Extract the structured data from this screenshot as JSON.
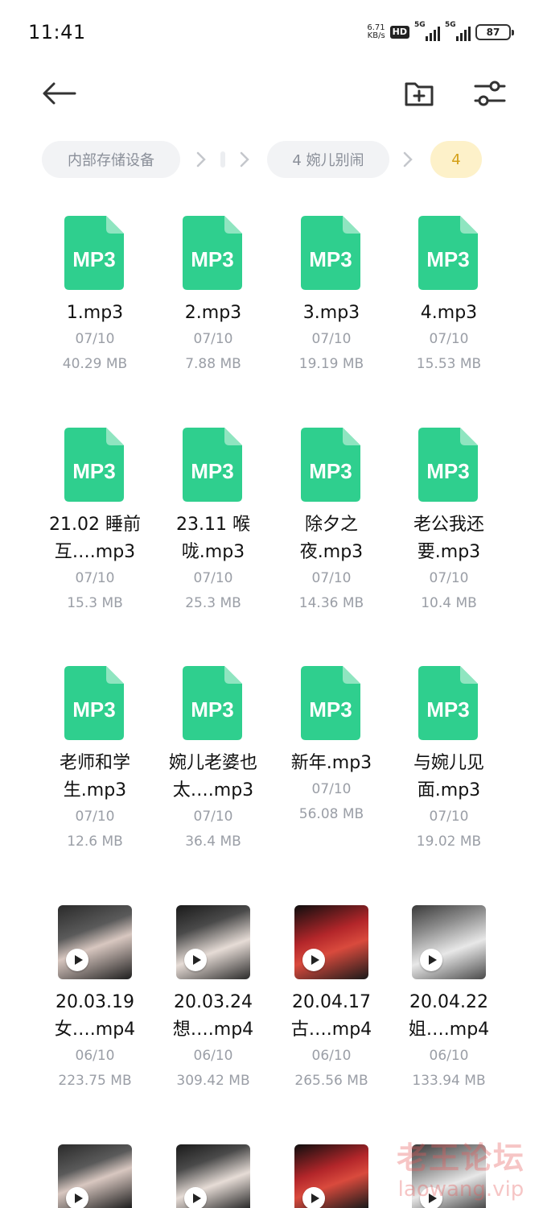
{
  "status": {
    "time": "11:41",
    "netspeed_value": "6.71",
    "netspeed_unit": "KB/s",
    "hd": "HD",
    "sim1": "5G",
    "sim2": "5G",
    "battery": "87"
  },
  "toolbar": {
    "back_icon": "arrow-left-icon",
    "new_folder_icon": "folder-add-icon",
    "filter_icon": "sliders-icon"
  },
  "breadcrumb": {
    "items": [
      "内部存储设备",
      "4 婉儿别闹",
      "4"
    ],
    "active_color": "#d4a017"
  },
  "files": [
    {
      "name_line1": "1.mp3",
      "name_line2": "",
      "date": "07/10",
      "size": "40.29 MB",
      "type": "MP3"
    },
    {
      "name_line1": "2.mp3",
      "name_line2": "",
      "date": "07/10",
      "size": "7.88 MB",
      "type": "MP3"
    },
    {
      "name_line1": "3.mp3",
      "name_line2": "",
      "date": "07/10",
      "size": "19.19 MB",
      "type": "MP3"
    },
    {
      "name_line1": "4.mp3",
      "name_line2": "",
      "date": "07/10",
      "size": "15.53 MB",
      "type": "MP3"
    },
    {
      "name_line1": "21.02 睡前",
      "name_line2": "互….mp3",
      "date": "07/10",
      "size": "15.3 MB",
      "type": "MP3"
    },
    {
      "name_line1": "23.11 喉",
      "name_line2": "咙.mp3",
      "date": "07/10",
      "size": "25.3 MB",
      "type": "MP3"
    },
    {
      "name_line1": "除夕之",
      "name_line2": "夜.mp3",
      "date": "07/10",
      "size": "14.36 MB",
      "type": "MP3"
    },
    {
      "name_line1": "老公我还",
      "name_line2": "要.mp3",
      "date": "07/10",
      "size": "10.4 MB",
      "type": "MP3"
    },
    {
      "name_line1": "老师和学",
      "name_line2": "生.mp3",
      "date": "07/10",
      "size": "12.6 MB",
      "type": "MP3"
    },
    {
      "name_line1": "婉儿老婆也",
      "name_line2": "太….mp3",
      "date": "07/10",
      "size": "36.4 MB",
      "type": "MP3"
    },
    {
      "name_line1": "新年.mp3",
      "name_line2": "",
      "date": "07/10",
      "size": "56.08 MB",
      "type": "MP3"
    },
    {
      "name_line1": "与婉儿见",
      "name_line2": "面.mp3",
      "date": "07/10",
      "size": "19.02 MB",
      "type": "MP3"
    },
    {
      "name_line1": "20.03.19",
      "name_line2": "女….mp4",
      "date": "06/10",
      "size": "223.75 MB",
      "type": "MP4"
    },
    {
      "name_line1": "20.03.24",
      "name_line2": "想….mp4",
      "date": "06/10",
      "size": "309.42 MB",
      "type": "MP4"
    },
    {
      "name_line1": "20.04.17",
      "name_line2": "古….mp4",
      "date": "06/10",
      "size": "265.56 MB",
      "type": "MP4"
    },
    {
      "name_line1": "20.04.22",
      "name_line2": "姐….mp4",
      "date": "06/10",
      "size": "133.94 MB",
      "type": "MP4"
    }
  ],
  "colors": {
    "mp3_icon": "#2fcf8e",
    "mp3_fold": "#8fe5c0",
    "meta_text": "#9a9ea6"
  },
  "watermark": {
    "line1": "老王论坛",
    "line2": "laowang.vip"
  }
}
